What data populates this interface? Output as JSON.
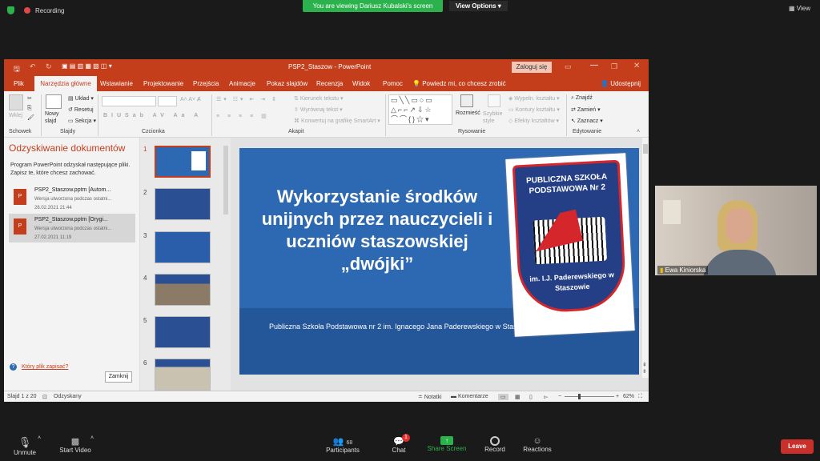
{
  "zoom": {
    "recording": "Recording",
    "viewing_banner": "You are viewing Dariusz Kubalski's screen",
    "view_options": "View Options",
    "view": "View",
    "participant_name": "Ewa Kiniorska",
    "toolbar": {
      "unmute": "Unmute",
      "start_video": "Start Video",
      "participants": "Participants",
      "participants_count": "68",
      "chat": "Chat",
      "chat_badge": "1",
      "share_screen": "Share Screen",
      "record": "Record",
      "reactions": "Reactions",
      "leave": "Leave"
    },
    "colors": {
      "green": "#2bb24c",
      "leave": "#c9302c",
      "share": "#2bb24c"
    }
  },
  "ppt": {
    "title": "PSP2_Staszow  -  PowerPoint",
    "signin": "Zaloguj się",
    "tabs": [
      "Plik",
      "Narzędzia główne",
      "Wstawianie",
      "Projektowanie",
      "Przejścia",
      "Animacje",
      "Pokaz slajdów",
      "Recenzja",
      "Widok",
      "Pomoc"
    ],
    "tellme": "Powiedz mi, co chcesz zrobić",
    "share": "Udostępnij",
    "ribbon": {
      "groups": [
        "Schowek",
        "Slajdy",
        "Czcionka",
        "Akapit",
        "Rysowanie",
        "Edytowanie"
      ],
      "wklej": "Wklej",
      "nowy_slajd": "Nowy slajd",
      "uklad": "Układ",
      "resetuj": "Resetuj",
      "sekcja": "Sekcja",
      "kierunek": "Kierunek tekstu",
      "wyrownaj": "Wyrównaj tekst",
      "smartart": "Konwertuj na grafikę SmartArt",
      "rozmiesc": "Rozmieść",
      "style": "Szybkie style",
      "wypeln": "Wypełn. kształtu",
      "kontury": "Kontury kształtu",
      "efekty": "Efekty kształtów",
      "znajdz": "Znajdź",
      "zamien": "Zamień",
      "zaznacz": "Zaznacz"
    },
    "recovery": {
      "title": "Odzyskiwanie dokumentów",
      "desc": "Program PowerPoint odzyskał następujące pliki. Zapisz te, które chcesz zachować.",
      "files": [
        {
          "name": "PSP2_Staszow.pptm  [Autom...",
          "desc": "Wersja utworzona podczas ostatni...",
          "date": "26.02.2021 21:44"
        },
        {
          "name": "PSP2_Staszow.pptm  [Orygi...",
          "desc": "Wersja utworzona podczas ostatni...",
          "date": "27.02.2021 11:19"
        }
      ],
      "help": "Który plik zapisać?",
      "close": "Zamknij"
    },
    "thumb_numbers": [
      "1",
      "2",
      "3",
      "4",
      "5",
      "6"
    ],
    "slide": {
      "title": "Wykorzystanie środków unijnych przez nauczycieli i uczniów staszowskiej „dwójki”",
      "subtitle": "Publiczna Szkoła Podstawowa nr 2 im. Ignacego Jana Paderewskiego w Staszowie",
      "logo_top": "PUBLICZNA SZKOŁA PODSTAWOWA Nr 2",
      "logo_bottom": "im. I.J. Paderewskiego w Staszowie"
    },
    "status": {
      "slide": "Slajd 1 z 20",
      "recovered": "Odzyskany",
      "notes": "Notatki",
      "comments": "Komentarze",
      "zoom": "62%"
    }
  }
}
